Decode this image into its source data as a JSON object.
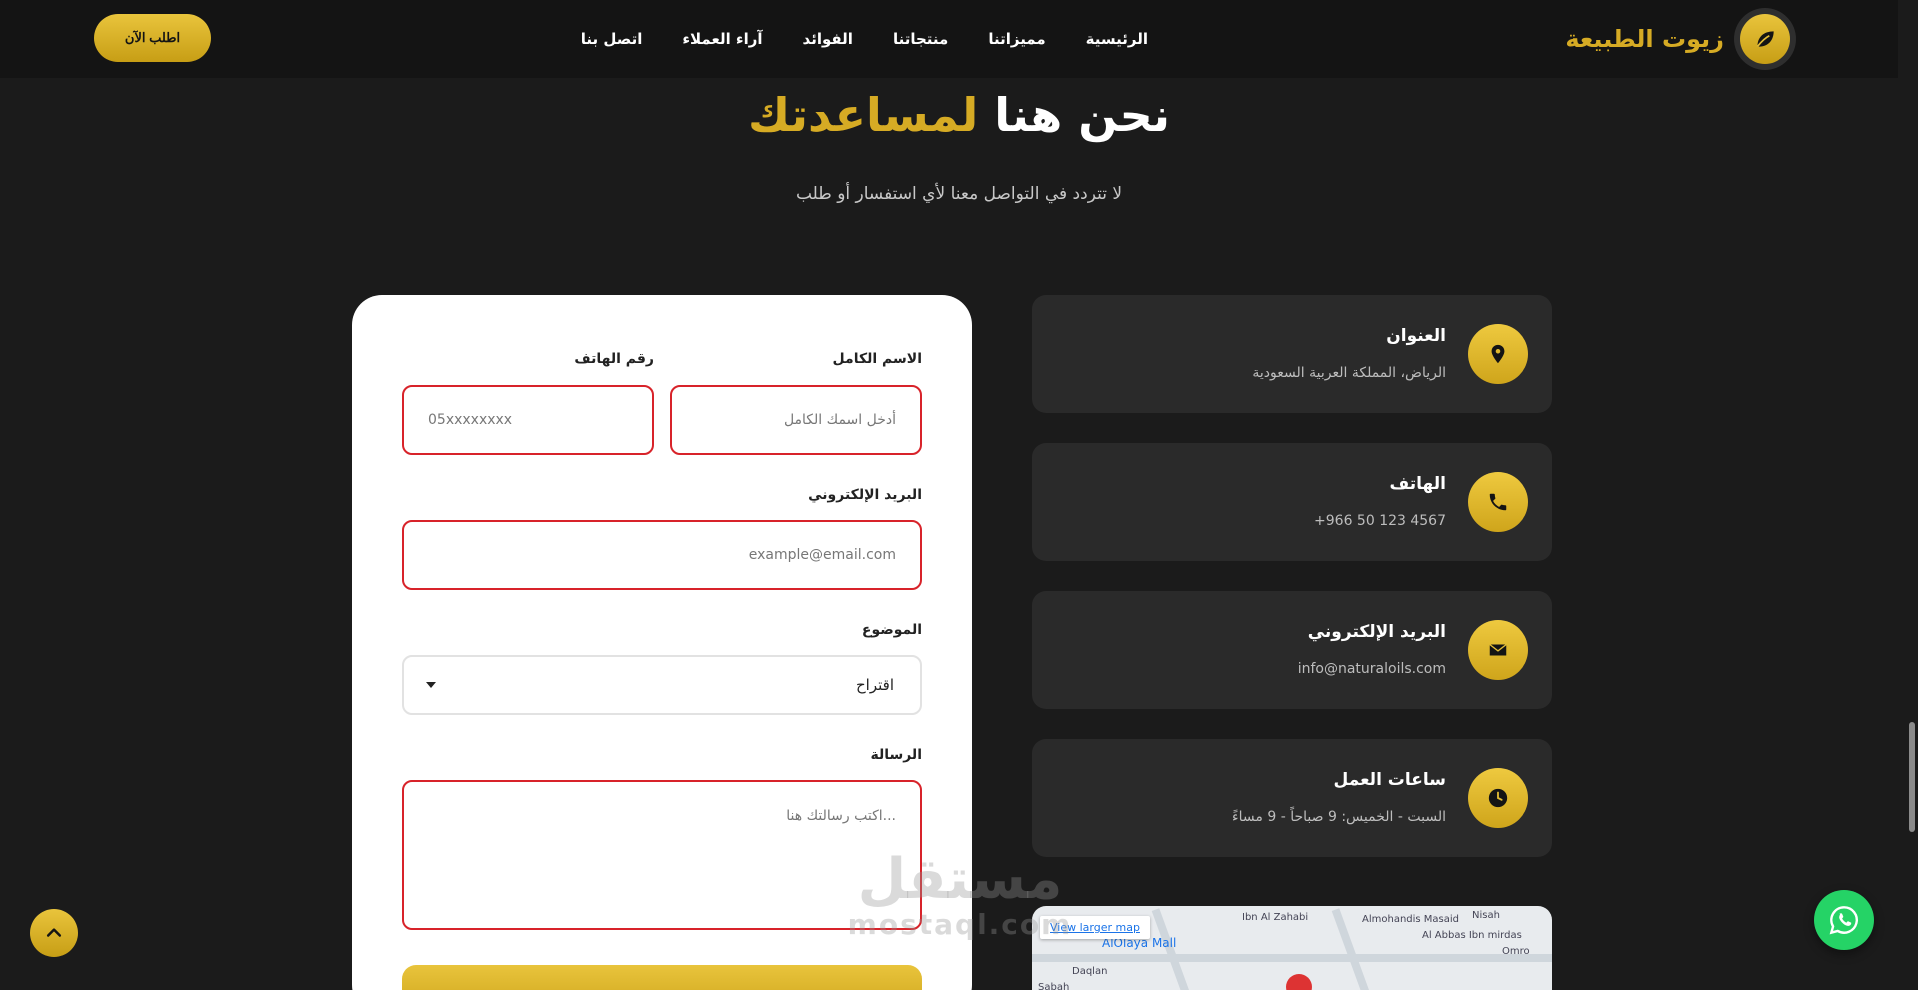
{
  "header": {
    "brand_name": "زيوت الطبيعة",
    "cta_label": "اطلب الآن",
    "nav": [
      "الرئيسية",
      "مميزاتنا",
      "منتجاتنا",
      "الفوائد",
      "آراء العملاء",
      "اتصل بنا"
    ]
  },
  "section": {
    "title_main": "نحن هنا",
    "title_accent": "لمساعدتك",
    "subtitle": "لا تتردد في التواصل معنا لأي استفسار أو طلب"
  },
  "form": {
    "name_label": "الاسم الكامل",
    "name_placeholder": "أدخل اسمك الكامل",
    "phone_label": "رقم الهاتف",
    "phone_placeholder": "05xxxxxxxx",
    "email_label": "البريد الإلكتروني",
    "email_placeholder": "example@email.com",
    "subject_label": "الموضوع",
    "subject_value": "اقتراح",
    "message_label": "الرسالة",
    "message_placeholder": "اكتب رسالتك هنا..."
  },
  "info": [
    {
      "title": "العنوان",
      "value": "الرياض، المملكة العربية السعودية",
      "icon": "location-pin-icon"
    },
    {
      "title": "الهاتف",
      "value": "+966 50 123 4567",
      "icon": "phone-icon"
    },
    {
      "title": "البريد الإلكتروني",
      "value": "info@naturaloils.com",
      "icon": "envelope-icon"
    },
    {
      "title": "ساعات العمل",
      "value": "السبت - الخميس: 9 صباحاً - 9 مساءً",
      "icon": "clock-icon"
    }
  ],
  "map": {
    "larger_map_label": "View larger map",
    "place_label": "AlOlaya Mall",
    "streets": [
      "Ibn Al Zahabi",
      "Almohandis Masaid",
      "Al Abbas Ibn mirdas",
      "Omro",
      "Nisah",
      "Daqlan",
      "Sabah"
    ]
  },
  "watermark": {
    "ar": "مستقل",
    "en": "mostaql.com"
  },
  "colors": {
    "accent": "#d6ab24",
    "background": "#1b1b1b",
    "card": "#2a2a2a",
    "error_border": "#d8232a",
    "whatsapp": "#25d366"
  }
}
